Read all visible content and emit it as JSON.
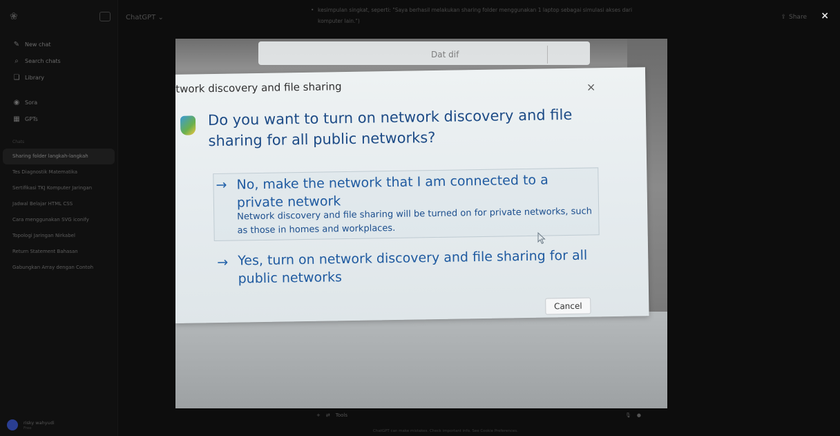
{
  "sidebar": {
    "nav": [
      {
        "icon": "edit-icon",
        "label": "New chat"
      },
      {
        "icon": "search-icon",
        "label": "Search chats"
      },
      {
        "icon": "library-icon",
        "label": "Library"
      },
      {
        "icon": "sora-icon",
        "label": "Sora"
      },
      {
        "icon": "gpts-icon",
        "label": "GPTs"
      }
    ],
    "section_label": "Chats",
    "chats": [
      "Sharing folder langkah-langkah",
      "Tes Diagnostik Matematika",
      "Sertifikasi TKJ Komputer Jaringan",
      "Jadwal Belajar HTML CSS",
      "Cara menggunakan SVG iconify",
      "Topologi Jaringan Nirkabel",
      "Return Statement Bahasan",
      "Gabungkan Array dengan Contoh"
    ],
    "active_chat_index": 0,
    "user": {
      "name": "risky wahyudi",
      "plan": "Free"
    }
  },
  "header": {
    "model": "ChatGPT",
    "share": "Share",
    "close": "×"
  },
  "background_message": "kesimpulan singkat, seperti: \"Saya berhasil melakukan sharing folder menggunakan 1 laptop sebagai simulasi akses dari komputer lain.\")",
  "composer": {
    "tools": "Tools"
  },
  "footer": "ChatGPT can make mistakes. Check important info. See Cookie Preferences.",
  "photo": {
    "dialog": {
      "title": "twork discovery and file sharing",
      "close": "×",
      "question": "Do you want to turn on network discovery and file sharing for all public networks?",
      "arrow": "→",
      "option1_label": "No, make the network that I am connected to a private network",
      "option1_desc": "Network discovery and file sharing will be turned on for private networks, such as those in homes and workplaces.",
      "option2_label": "Yes, turn on network discovery and file sharing for all public networks",
      "cancel": "Cancel"
    },
    "behind_text": "Dat dif",
    "behind_close": "×"
  }
}
